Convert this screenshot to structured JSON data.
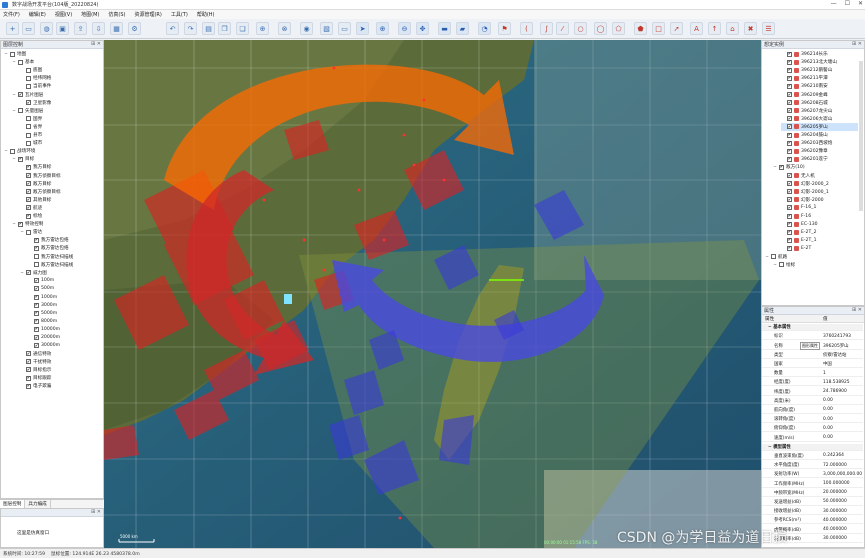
{
  "window": {
    "title": "数字战场开发平台(104版_20220824)",
    "min": "—",
    "max": "☐",
    "close": "✕"
  },
  "menu": [
    "文件(F)",
    "编辑(E)",
    "视图(V)",
    "地图(M)",
    "仿真(S)",
    "资源管理(R)",
    "工具(T)",
    "帮助(H)"
  ],
  "toolbar_icons": [
    "add-icon",
    "folder-icon",
    "globe-icon",
    "save-icon",
    "export-icon",
    "import-icon",
    "grid-icon",
    "settings-icon",
    "undo-icon",
    "redo-icon",
    "page-icon",
    "copy-icon",
    "copy2-icon",
    "crosshair-icon",
    "crosshair2-icon",
    "camera-icon",
    "image-icon",
    "monitor-icon",
    "cursor-icon",
    "zoom-in-icon",
    "zoom-out-icon",
    "pan-icon",
    "ruler-icon",
    "area-icon",
    "measure-icon",
    "flag-icon",
    "arc-icon",
    "curve-icon",
    "line-icon",
    "circle-icon",
    "ellipse-icon",
    "polygon-icon",
    "pentagon-icon",
    "rect-icon",
    "arrow-icon",
    "text-icon",
    "up-arrow-icon",
    "home-icon",
    "delete-icon",
    "layers-icon"
  ],
  "left_panel": {
    "title": "图层控制",
    "rows": [
      {
        "label": "地图",
        "level": 0,
        "checked": false,
        "exp": "−"
      },
      {
        "label": "基本",
        "level": 1,
        "checked": false,
        "exp": "−"
      },
      {
        "label": "底图",
        "level": 2,
        "checked": false
      },
      {
        "label": "经纬网格",
        "level": 2,
        "checked": false
      },
      {
        "label": "当前事件",
        "level": 2,
        "checked": false
      },
      {
        "label": "瓦片图层",
        "level": 1,
        "checked": true,
        "exp": "−"
      },
      {
        "label": "卫星影像",
        "level": 2,
        "checked": true
      },
      {
        "label": "矢量图层",
        "level": 1,
        "checked": false,
        "exp": "−"
      },
      {
        "label": "国界",
        "level": 2,
        "checked": false
      },
      {
        "label": "省界",
        "level": 2,
        "checked": false
      },
      {
        "label": "县市",
        "level": 2,
        "checked": false
      },
      {
        "label": "城市",
        "level": 2,
        "checked": false
      },
      {
        "label": "战场环境",
        "level": 0,
        "checked": false,
        "exp": "−"
      },
      {
        "label": "目标",
        "level": 1,
        "checked": true,
        "exp": "−"
      },
      {
        "label": "我方目标",
        "level": 2,
        "checked": true
      },
      {
        "label": "我方侦察目标",
        "level": 2,
        "checked": true
      },
      {
        "label": "敌方目标",
        "level": 2,
        "checked": true
      },
      {
        "label": "敌方侦察目标",
        "level": 2,
        "checked": true
      },
      {
        "label": "其他目标",
        "level": 2,
        "checked": true
      },
      {
        "label": "航迹",
        "level": 2,
        "checked": true
      },
      {
        "label": "标绘",
        "level": 2,
        "checked": true
      },
      {
        "label": "特效控制",
        "level": 1,
        "checked": true,
        "exp": "−"
      },
      {
        "label": "雷达",
        "level": 2,
        "checked": false,
        "exp": "−"
      },
      {
        "label": "我方雷达包络",
        "level": 3,
        "checked": true
      },
      {
        "label": "敌方雷达包络",
        "level": 3,
        "checked": true
      },
      {
        "label": "我方雷达扫描线",
        "level": 3,
        "checked": false
      },
      {
        "label": "敌方雷达扫描线",
        "level": 3,
        "checked": false
      },
      {
        "label": "威力图",
        "level": 2,
        "checked": true,
        "exp": "−"
      },
      {
        "label": "100m",
        "level": 3,
        "checked": true
      },
      {
        "label": "500m",
        "level": 3,
        "checked": true
      },
      {
        "label": "1000m",
        "level": 3,
        "checked": true
      },
      {
        "label": "3000m",
        "level": 3,
        "checked": true
      },
      {
        "label": "5000m",
        "level": 3,
        "checked": true
      },
      {
        "label": "8000m",
        "level": 3,
        "checked": true
      },
      {
        "label": "10000m",
        "level": 3,
        "checked": true
      },
      {
        "label": "20000m",
        "level": 3,
        "checked": true
      },
      {
        "label": "30000m",
        "level": 3,
        "checked": true
      },
      {
        "label": "通信特效",
        "level": 2,
        "checked": true
      },
      {
        "label": "干扰特效",
        "level": 2,
        "checked": true
      },
      {
        "label": "目标指示",
        "level": 2,
        "checked": true
      },
      {
        "label": "目标跟踪",
        "level": 2,
        "checked": true
      },
      {
        "label": "电子欺骗",
        "level": 2,
        "checked": true
      }
    ]
  },
  "left_tabs": [
    "图层控制",
    "兵力编成"
  ],
  "left_bottom_panel": {
    "title": "",
    "text": "这里是仿真窗口"
  },
  "right_panel": {
    "title": "想定实例",
    "rows": [
      {
        "label": "396214长乐",
        "level": 2,
        "checked": true
      },
      {
        "label": "396213北大塘山",
        "level": 2,
        "checked": true
      },
      {
        "label": "396212鹅髻山",
        "level": 2,
        "checked": true
      },
      {
        "label": "396211平潭",
        "level": 2,
        "checked": true
      },
      {
        "label": "396210南安",
        "level": 2,
        "checked": true
      },
      {
        "label": "396209金峰",
        "level": 2,
        "checked": true
      },
      {
        "label": "396208石城",
        "level": 2,
        "checked": true
      },
      {
        "label": "396207龙尖山",
        "level": 2,
        "checked": true
      },
      {
        "label": "396206大嵛山",
        "level": 2,
        "checked": true
      },
      {
        "label": "396205罗山",
        "level": 2,
        "checked": true,
        "selected": true
      },
      {
        "label": "396204鼓山",
        "level": 2,
        "checked": true
      },
      {
        "label": "396203西坡炮",
        "level": 2,
        "checked": true
      },
      {
        "label": "396202豫章",
        "level": 2,
        "checked": true
      },
      {
        "label": "396201莲宁",
        "level": 2,
        "checked": true
      },
      {
        "label": "敌方(10)",
        "level": 1,
        "checked": true,
        "exp": "−"
      },
      {
        "label": "无人机",
        "level": 2,
        "checked": true
      },
      {
        "label": "幻影-2000_2",
        "level": 2,
        "checked": true
      },
      {
        "label": "幻影-2000_1",
        "level": 2,
        "checked": true
      },
      {
        "label": "幻影-2000",
        "level": 2,
        "checked": true
      },
      {
        "label": "F-16_1",
        "level": 2,
        "checked": true
      },
      {
        "label": "F-16",
        "level": 2,
        "checked": true
      },
      {
        "label": "EC-130",
        "level": 2,
        "checked": true
      },
      {
        "label": "E-2T_2",
        "level": 2,
        "checked": true
      },
      {
        "label": "E-2T_1",
        "level": 2,
        "checked": true
      },
      {
        "label": "E-2T",
        "level": 2,
        "checked": true
      },
      {
        "label": "航路",
        "level": 0,
        "checked": false,
        "exp": "−"
      },
      {
        "label": "绘标",
        "level": 1,
        "checked": false,
        "exp": "−"
      }
    ]
  },
  "properties": {
    "title": "属性",
    "header": [
      "属性",
      "值"
    ],
    "rows": [
      {
        "k": "基本属性",
        "v": "",
        "group": true
      },
      {
        "k": "标识",
        "v": "3760241793"
      },
      {
        "k": "名称",
        "v": "396205罗山",
        "extra": "图形属性"
      },
      {
        "k": "类型",
        "v": "侦察/雷达站"
      },
      {
        "k": "国家",
        "v": "中国"
      },
      {
        "k": "数量",
        "v": "1"
      },
      {
        "k": "经度(度)",
        "v": "118.538925"
      },
      {
        "k": "纬度(度)",
        "v": "24.786900"
      },
      {
        "k": "高度(米)",
        "v": "0.00"
      },
      {
        "k": "航向角(度)",
        "v": "0.00"
      },
      {
        "k": "滚转角(度)",
        "v": "0.00"
      },
      {
        "k": "俯仰角(度)",
        "v": "0.00"
      },
      {
        "k": "速度(m/s)",
        "v": "0.00"
      },
      {
        "k": "模型属性",
        "v": "",
        "group": true
      },
      {
        "k": "垂直波束角(度)",
        "v": "0.242364"
      },
      {
        "k": "水平角度(度)",
        "v": "72.000000"
      },
      {
        "k": "发射功率(W)",
        "v": "3,000,000,000.00"
      },
      {
        "k": "工作频率(MHz)",
        "v": "100.000000"
      },
      {
        "k": "中频带宽(MHz)",
        "v": "20.000000"
      },
      {
        "k": "发送增益(dB)",
        "v": "50.000000"
      },
      {
        "k": "接收增益(dB)",
        "v": "30.000000"
      },
      {
        "k": "参考RCS(m²)",
        "v": "40.000000"
      },
      {
        "k": "虚警概率(dB)",
        "v": "40.000000"
      },
      {
        "k": "发现概率(dB)",
        "v": "30.000000"
      }
    ]
  },
  "statusbar": {
    "time": "系统时间: 10:27:59",
    "mouse": "鼠标位置: 124.914E 26.23 4580378.0m",
    "map_coords": "00:00:00  01:15:58  FPS: 58"
  },
  "watermark": "CSDN @为学日益为道日损",
  "scale_label": "5000 km",
  "colors": {
    "orange_zone": "#ff6a00",
    "red_zone": "#e02020",
    "blue_zone": "#4a4ae0",
    "panel_bg": "#ffffff",
    "toolbar_bg": "#eef2f7"
  }
}
